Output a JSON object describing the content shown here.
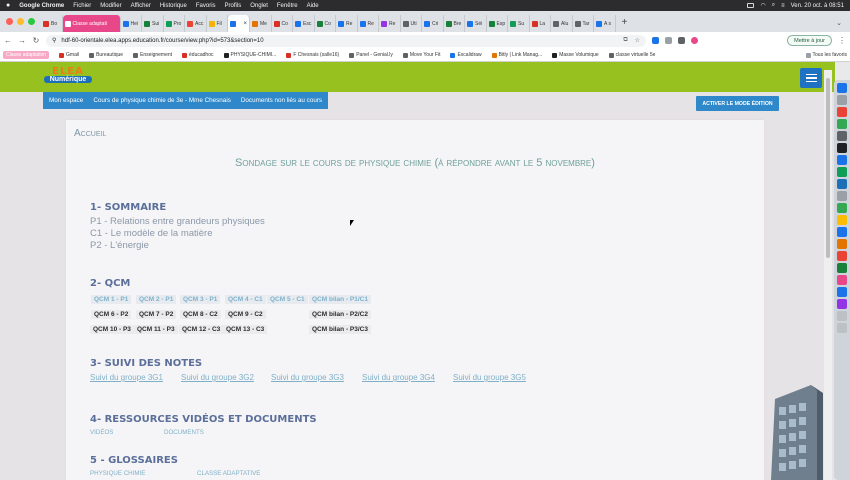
{
  "menubar": {
    "app": "Google Chrome",
    "items": [
      "Fichier",
      "Modifier",
      "Afficher",
      "Historique",
      "Favoris",
      "Profils",
      "Onglet",
      "Fenêtre",
      "Aide"
    ],
    "clock": "Ven. 20 oct. à 08:51"
  },
  "tabs": [
    {
      "label": "Bo",
      "color": "#d93025"
    },
    {
      "label": "Classe adaptati",
      "color": "#ffffff",
      "highlight": true
    },
    {
      "label": "Hei",
      "color": "#1a73e8"
    },
    {
      "label": "Sui",
      "color": "#188038"
    },
    {
      "label": "Pro",
      "color": "#0f9d58"
    },
    {
      "label": "Acc",
      "color": "#ea4335"
    },
    {
      "label": "Fil",
      "color": "#f4b400"
    },
    {
      "label": "",
      "color": "#1a73e8",
      "active": true
    },
    {
      "label": "Me",
      "color": "#e37400"
    },
    {
      "label": "Co",
      "color": "#d93025"
    },
    {
      "label": "Esc",
      "color": "#1a73e8"
    },
    {
      "label": "Co",
      "color": "#188038"
    },
    {
      "label": "Re",
      "color": "#1a73e8"
    },
    {
      "label": "Re",
      "color": "#1a73e8"
    },
    {
      "label": "Re",
      "color": "#9334e6"
    },
    {
      "label": "Uti",
      "color": "#5f6368"
    },
    {
      "label": "Cri",
      "color": "#1a73e8"
    },
    {
      "label": "Bre",
      "color": "#188038"
    },
    {
      "label": "Séi",
      "color": "#1a73e8"
    },
    {
      "label": "Esp",
      "color": "#188038"
    },
    {
      "label": "Su",
      "color": "#0f9d58"
    },
    {
      "label": "La",
      "color": "#d93025"
    },
    {
      "label": "Alu",
      "color": "#5f6368"
    },
    {
      "label": "Tar",
      "color": "#5f6368"
    },
    {
      "label": "A s",
      "color": "#1a73e8"
    }
  ],
  "address": {
    "url": "hdf-60-orientale.elea.apps.education.fr/course/view.php?id=573&section=10",
    "update_label": "Mettre à jour"
  },
  "bookmarks": {
    "items": [
      {
        "label": "Classe adaptation",
        "color": "#f7a8c4",
        "pink": true
      },
      {
        "label": "Gmail",
        "color": "#d93025"
      },
      {
        "label": "Bureautique",
        "color": "#5f6368"
      },
      {
        "label": "Enseignement",
        "color": "#5f6368"
      },
      {
        "label": "éducadhoc",
        "color": "#d93025"
      },
      {
        "label": "PHYSIQUE-CHIMI...",
        "color": "#202124"
      },
      {
        "label": "F Chesnais (salle16)",
        "color": "#d93025"
      },
      {
        "label": "Panel - Genial.ly",
        "color": "#5f6368"
      },
      {
        "label": "Move Your Fit",
        "color": "#5f6368"
      },
      {
        "label": "Excalidraw",
        "color": "#1a73e8"
      },
      {
        "label": "Bitly | Link Manag...",
        "color": "#e37400"
      },
      {
        "label": "Masse Volumique",
        "color": "#202124"
      },
      {
        "label": "classe virtuelle 5e",
        "color": "#5f6368"
      }
    ],
    "all_label": "Tous les favoris"
  },
  "site": {
    "logo_top": "ELEA",
    "logo_bottom": "Numérique",
    "breadcrumb": [
      "Mon espace",
      "Cours de physique chimie de 3e - Mme Chesnais",
      "Documents non liés au cours"
    ],
    "edit_mode": "ACTIVER LE MODE ÉDITION"
  },
  "course": {
    "title": "Accueil",
    "survey": "Sondage sur le cours de physique chimie (à répondre avant le 5 novembre)",
    "sommaire": {
      "heading": "1- SOMMAIRE",
      "items": [
        "P1 - Relations entre grandeurs physiques",
        "C1 - Le modèle de la matière",
        "P2 - L'énergie"
      ]
    },
    "qcm": {
      "heading": "2- QCM",
      "row1": [
        "QCM 1 - P1",
        "QCM 2 - P1",
        "QCM 3 - P1",
        "QCM 4 - C1",
        "QCM 5 - C1",
        "QCM bilan - P1/C1"
      ],
      "row2": [
        "QCM 6 - P2",
        "QCM 7 - P2",
        "QCM 8 - C2",
        "QCM 9 - C2",
        "QCM bilan - P2/C2"
      ],
      "row3": [
        "QCM 10 - P3",
        "QCM 11 - P3",
        "QCM 12 - C3",
        "QCM 13 - C3",
        "QCM bilan - P3/C3"
      ]
    },
    "suivi": {
      "heading": "3- SUIVI DES NOTES",
      "links": [
        "Suivi du groupe 3G1",
        "Suivi du groupe 3G2",
        "Suivi du groupe 3G3",
        "Suivi du groupe 3G4",
        "Suivi du groupe 3G5"
      ]
    },
    "ressources": {
      "heading": "4- RESSOURCES VIDÉOS ET DOCUMENTS",
      "links": [
        "VIDÉOS",
        "DOCUMENTS"
      ]
    },
    "glossaires": {
      "heading": "5 - GLOSSAIRES",
      "links": [
        "PHYSIQUE CHIMIE",
        "CLASSE ADAPTATIVE"
      ]
    }
  }
}
